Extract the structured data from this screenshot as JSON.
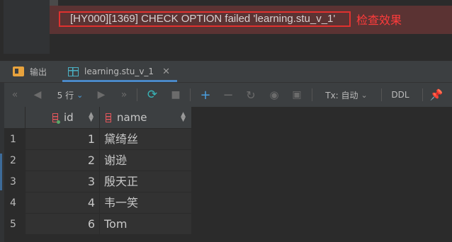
{
  "error": {
    "message": "[HY000][1369] CHECK OPTION failed 'learning.stu_v_1'",
    "annotation": "检查效果"
  },
  "tabs": [
    {
      "label": "输出",
      "icon": "output-icon"
    },
    {
      "label": "learning.stu_v_1",
      "icon": "table-grid-icon",
      "active": true
    }
  ],
  "toolbar": {
    "rows_label": "5 行",
    "tx_label": "Tx: 自动",
    "ddl_label": "DDL"
  },
  "table": {
    "columns": [
      {
        "name": "id"
      },
      {
        "name": "name"
      }
    ],
    "rows": [
      {
        "num": "1",
        "id": "1",
        "name": "黛绮丝"
      },
      {
        "num": "2",
        "id": "2",
        "name": "谢逊"
      },
      {
        "num": "3",
        "id": "3",
        "name": "殷天正"
      },
      {
        "num": "4",
        "id": "4",
        "name": "韦一笑"
      },
      {
        "num": "5",
        "id": "6",
        "name": "Tom"
      }
    ]
  },
  "colors": {
    "accent": "#4a88c7",
    "error_border": "#e0312f",
    "annotation": "#ff3b3b"
  }
}
